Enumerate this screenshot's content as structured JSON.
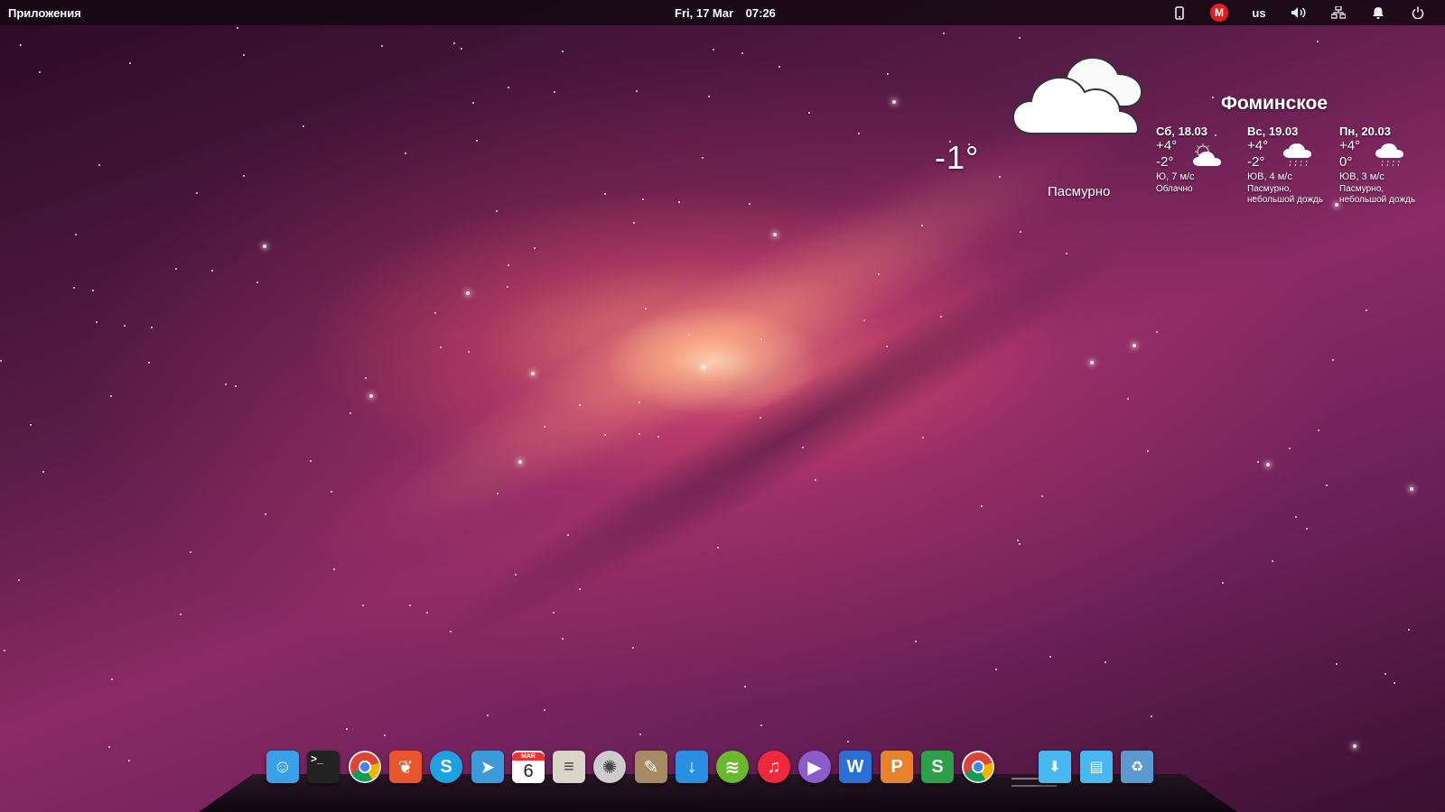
{
  "top_panel": {
    "apps_menu": "Приложения",
    "date": "Fri, 17 Mar",
    "time": "07:26",
    "keyboard_layout": "us"
  },
  "weather": {
    "current_temp": "-1°",
    "current_condition": "Пасмурно",
    "city": "Фоминское",
    "forecast": [
      {
        "date": "Сб, 18.03",
        "high": "+4°",
        "low": "-2°",
        "wind": "Ю, 7 м/с",
        "condition": "Облачно",
        "icon": "partly-cloudy-icon"
      },
      {
        "date": "Вс, 19.03",
        "high": "+4°",
        "low": "-2°",
        "wind": "ЮВ, 4 м/с",
        "condition": "Пасмурно, небольшой дождь",
        "icon": "light-rain-icon"
      },
      {
        "date": "Пн, 20.03",
        "high": "+4°",
        "low": "0°",
        "wind": "ЮВ, 3 м/с",
        "condition": "Пасмурно, небольшой дождь",
        "icon": "light-rain-icon"
      }
    ]
  },
  "dock": {
    "calendar_day": "6",
    "calendar_month": "MAR",
    "apps": [
      {
        "name": "finder-icon",
        "color": "#3aa0e8"
      },
      {
        "name": "terminal-icon",
        "color": "#222222"
      },
      {
        "name": "chrome-icon",
        "color": "#e8e8e8"
      },
      {
        "name": "scripts-icon",
        "color": "#e8552a"
      },
      {
        "name": "skype-icon",
        "color": "#1da1e2"
      },
      {
        "name": "telegram-icon",
        "color": "#3b9ad9"
      },
      {
        "name": "calendar-icon",
        "color": "#ffffff"
      },
      {
        "name": "notes-icon",
        "color": "#d9d4c8"
      },
      {
        "name": "aperture-icon",
        "color": "#cccccc"
      },
      {
        "name": "gimp-icon",
        "color": "#a68a64"
      },
      {
        "name": "download-icon",
        "color": "#2a8fe0"
      },
      {
        "name": "spotify-icon",
        "color": "#6ab82c"
      },
      {
        "name": "music-icon",
        "color": "#f0283c"
      },
      {
        "name": "player-icon",
        "color": "#8b5ccc"
      },
      {
        "name": "writer-icon",
        "color": "#2b6fd6"
      },
      {
        "name": "presentation-icon",
        "color": "#e8822a"
      },
      {
        "name": "spreadsheet-icon",
        "color": "#2ca048"
      },
      {
        "name": "chrome-icon",
        "color": "#e8e8e8"
      }
    ],
    "folders": [
      {
        "name": "downloads-folder-icon",
        "color": "#4ab8f0"
      },
      {
        "name": "documents-folder-icon",
        "color": "#4ab8f0"
      },
      {
        "name": "trash-icon",
        "color": "#5a9ad0"
      }
    ]
  }
}
